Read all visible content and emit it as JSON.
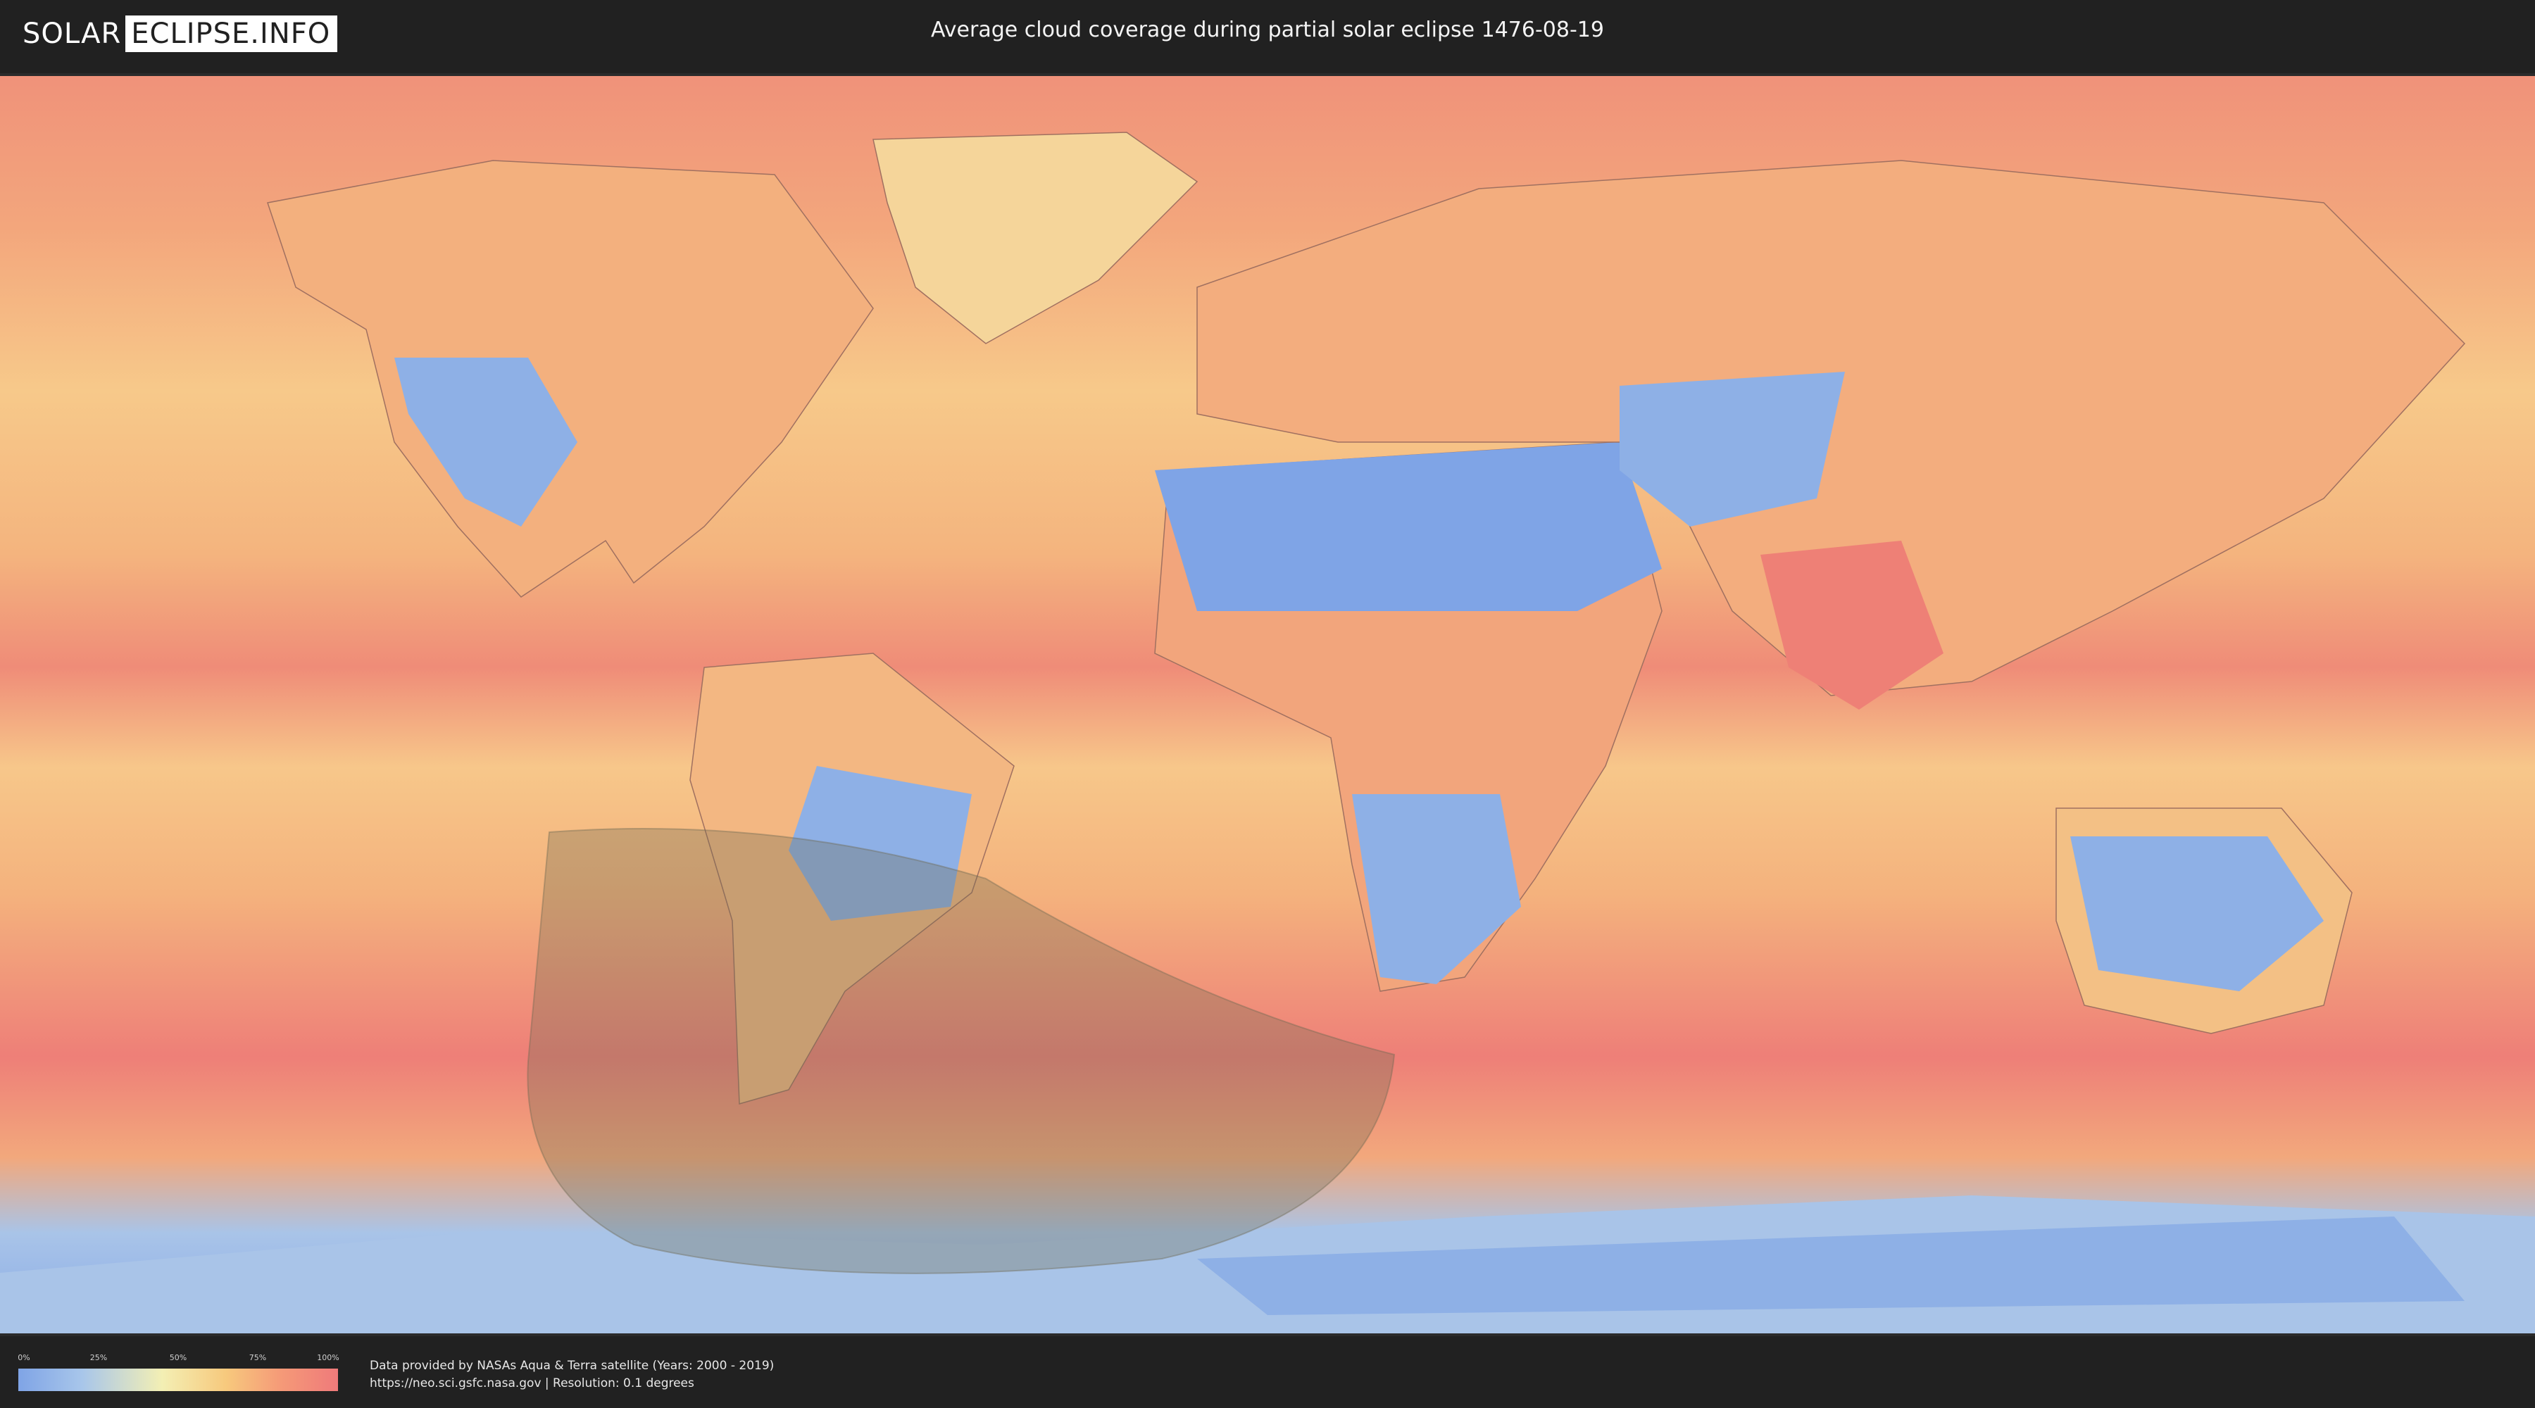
{
  "brand": {
    "part1": "SOLAR",
    "part2": "ECLIPSE.INFO"
  },
  "title": "Average cloud coverage during partial solar eclipse 1476-08-19",
  "legend": {
    "ticks": [
      "0%",
      "25%",
      "50%",
      "75%",
      "100%"
    ],
    "scale_colors": [
      "#7fa4e6",
      "#a8c6ea",
      "#f3efb4",
      "#f7c97d",
      "#f59a78",
      "#ef7a7a"
    ]
  },
  "attribution": {
    "line1": "Data provided by NASAs Aqua & Terra satellite (Years: 2000 - 2019)",
    "line2": "https://neo.sci.gsfc.nasa.gov | Resolution: 0.1 degrees"
  },
  "map": {
    "ocean_color": "#f4b27d",
    "cloudy_band_color": "#ee7f78",
    "clear_color": "#7fa4e6",
    "eclipse_shadow_color": "#6e6a52"
  }
}
